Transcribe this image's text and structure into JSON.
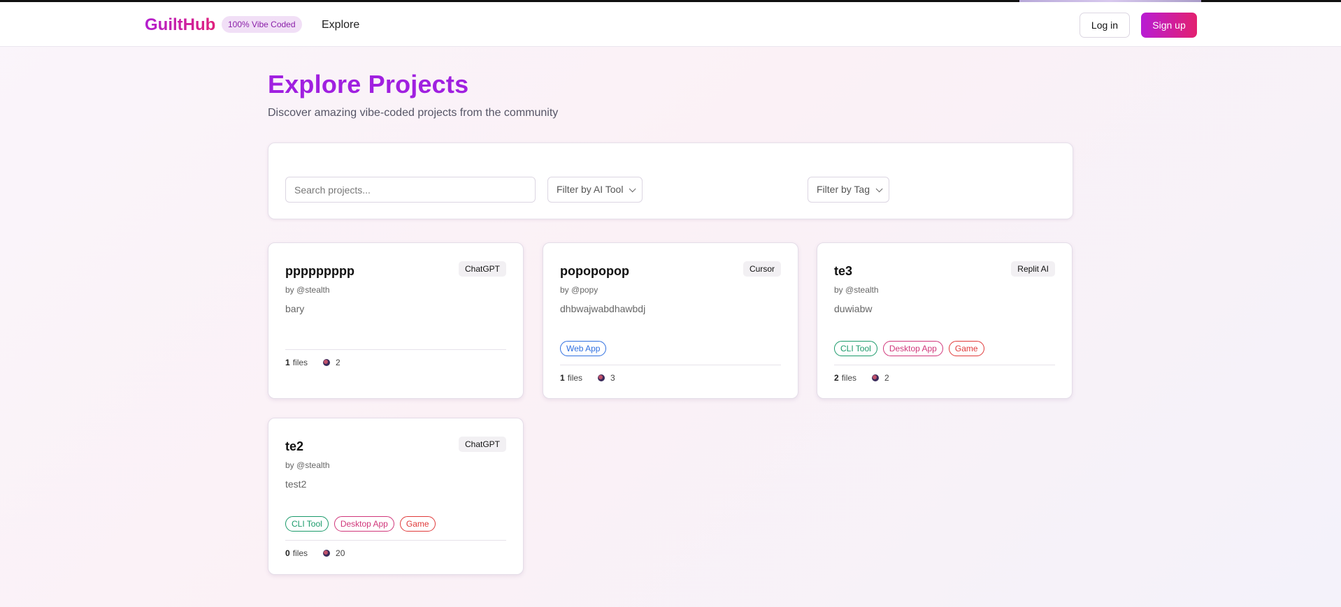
{
  "header": {
    "logo": "GuiltHub",
    "badge": "100% Vibe Coded",
    "nav_explore": "Explore",
    "login": "Log in",
    "signup": "Sign up"
  },
  "page": {
    "title": "Explore Projects",
    "subtitle": "Discover amazing vibe-coded projects from the community"
  },
  "filters": {
    "search_placeholder": "Search projects...",
    "ai_tool": "Filter by AI Tool",
    "tag": "Filter by Tag"
  },
  "projects": [
    {
      "title": "ppppppppp",
      "tool": "ChatGPT",
      "author": "by @stealth",
      "description": "bary",
      "tags": [],
      "files": "1",
      "files_label": "files",
      "views": "2"
    },
    {
      "title": "popopopop",
      "tool": "Cursor",
      "author": "by @popy",
      "description": "dhbwajwabdhawbdj",
      "tags": [
        "Web App"
      ],
      "files": "1",
      "files_label": "files",
      "views": "3"
    },
    {
      "title": "te3",
      "tool": "Replit AI",
      "author": "by @stealth",
      "description": "duwiabw",
      "tags": [
        "CLI Tool",
        "Desktop App",
        "Game"
      ],
      "files": "2",
      "files_label": "files",
      "views": "2"
    },
    {
      "title": "te2",
      "tool": "ChatGPT",
      "author": "by @stealth",
      "description": "test2",
      "tags": [
        "CLI Tool",
        "Desktop App",
        "Game"
      ],
      "files": "0",
      "files_label": "files",
      "views": "20"
    }
  ],
  "tag_colors": {
    "Web App": "blue",
    "CLI Tool": "green",
    "Desktop App": "pink",
    "Game": "red"
  },
  "colors": {
    "brand_purple": "#a020e0",
    "brand_pink": "#e3206f"
  }
}
